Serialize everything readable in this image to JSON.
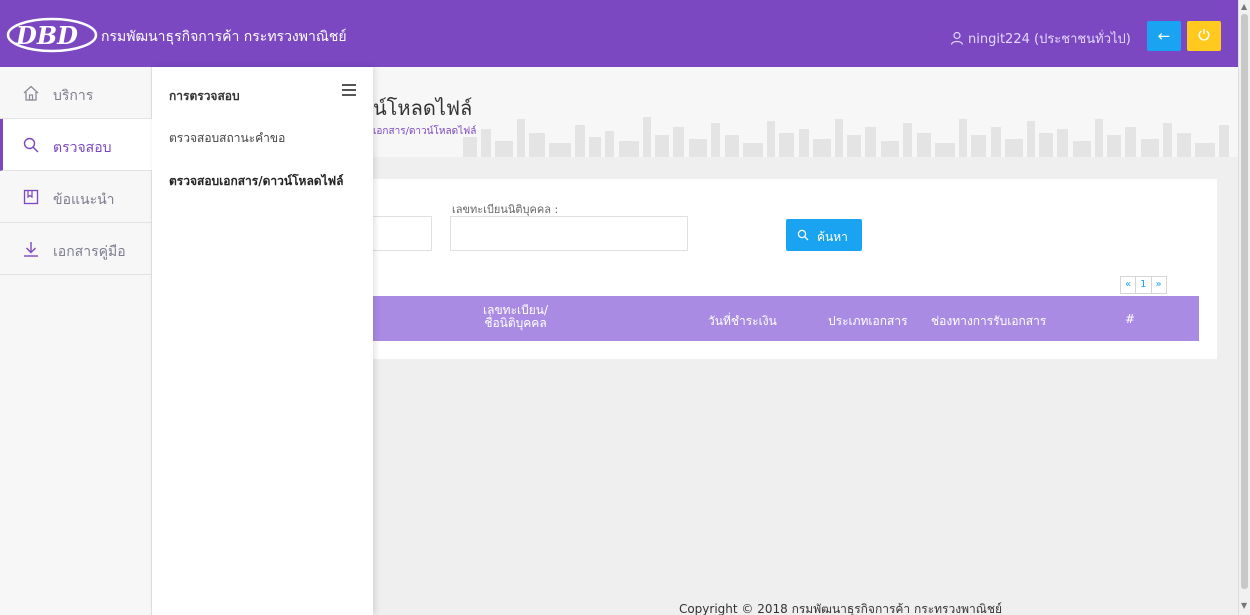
{
  "header": {
    "logo_text": "DBD",
    "org_name": "กรมพัฒนาธุรกิจการค้า กระทรวงพาณิชย์",
    "user_label": "ningit224 (ประชาชนทั่วไป)",
    "back_icon": "←",
    "brand_color": "#7b48c2"
  },
  "sidebar": {
    "items": [
      {
        "label": "บริการ",
        "icon": "home-icon"
      },
      {
        "label": "ตรวจสอบ",
        "icon": "search-icon",
        "active": true
      },
      {
        "label": "ข้อแนะนำ",
        "icon": "bookmark-icon"
      },
      {
        "label": "เอกสารคู่มือ",
        "icon": "download-icon"
      }
    ]
  },
  "submenu": {
    "title": "การตรวจสอบ",
    "items": [
      {
        "label": "ตรวจสอบสถานะคำขอ"
      },
      {
        "label": "ตรวจสอบเอกสาร/ดาวน์โหลดไฟล์",
        "active": true
      }
    ]
  },
  "page": {
    "title": "น์โหลดไฟล์",
    "breadcrumb": "เอกสาร/ดาวน์โหลดไฟล์"
  },
  "search": {
    "reg_label": "เลขทะเบียนนิติบุคคล :",
    "reg_value": "",
    "button_label": "ค้นหา"
  },
  "pagination": {
    "prev": "«",
    "current": "1",
    "next": "»"
  },
  "table": {
    "headers": [
      "เลขทะเบียน/\nชื่อนิติบุคคล",
      "วันที่ชำระเงิน",
      "ประเภทเอกสาร",
      "ช่องทางการรับเอกสาร",
      "#"
    ],
    "header_color": "#a98be3"
  },
  "footer": {
    "copyright": "Copyright © 2018 กรมพัฒนาธุรกิจการค้า กระทรวงพาณิชย์"
  }
}
